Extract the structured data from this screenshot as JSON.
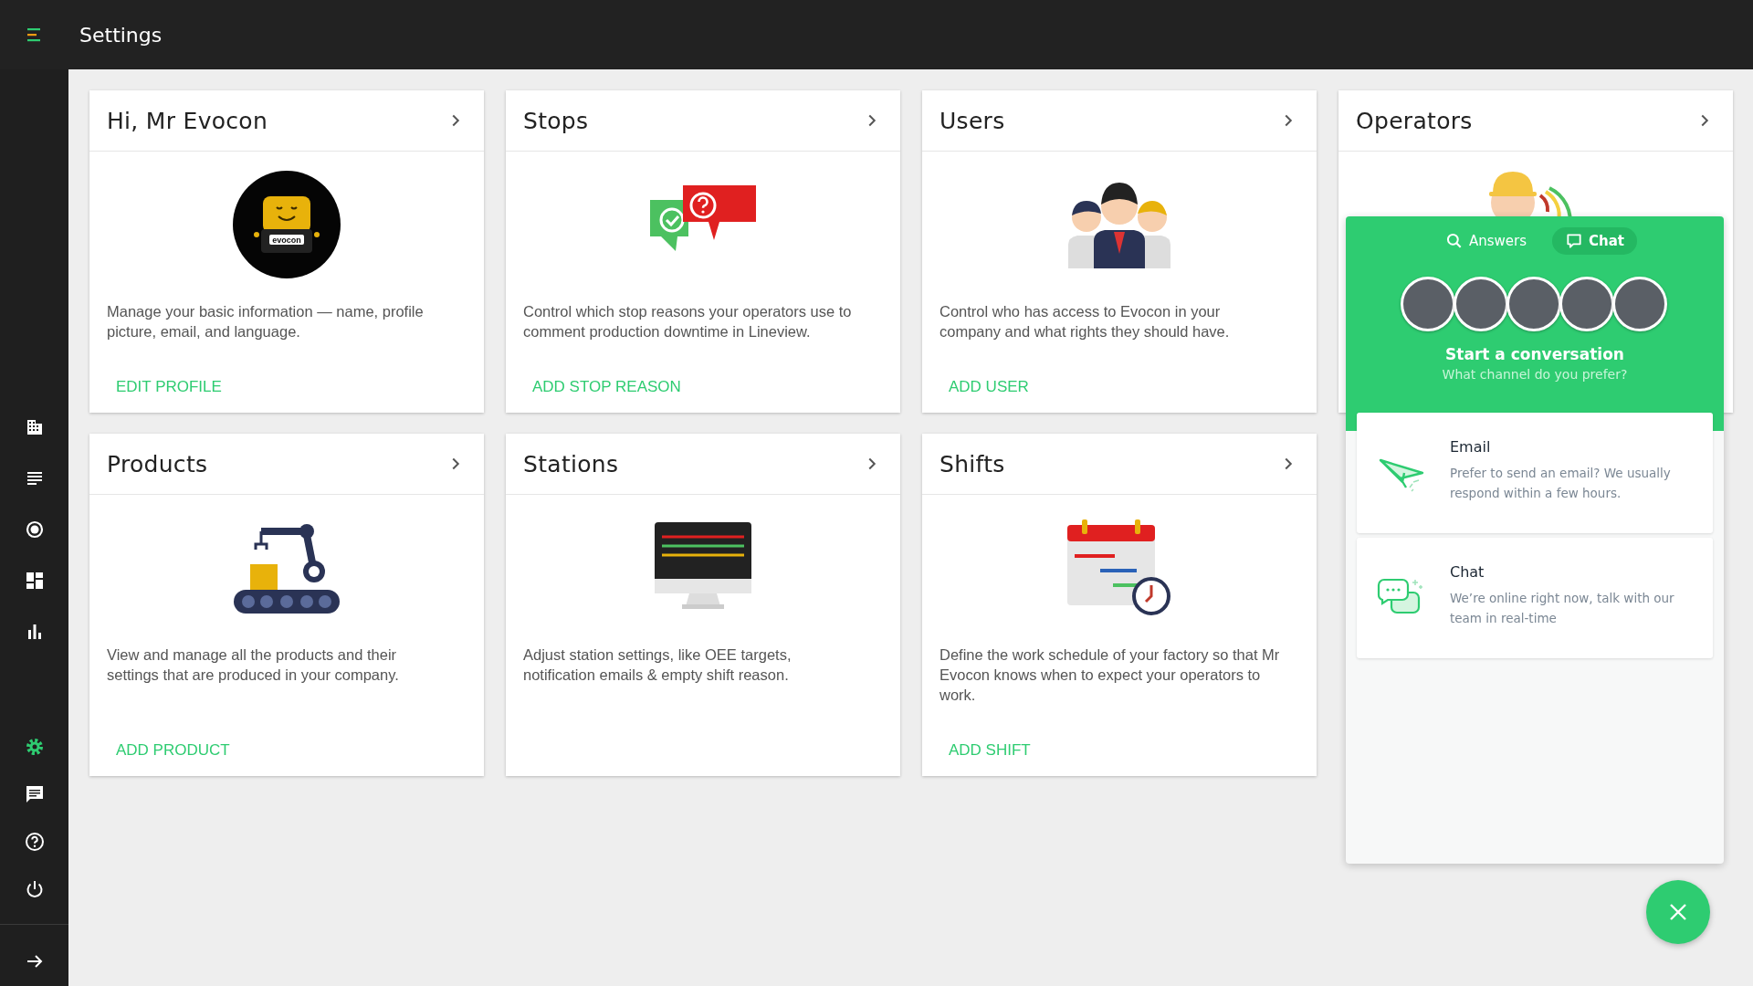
{
  "top_bar": {
    "title": "Settings"
  },
  "sidebar": {
    "items": [
      {
        "kind": "building",
        "selected": false
      },
      {
        "kind": "list",
        "selected": false
      },
      {
        "kind": "target",
        "selected": false
      },
      {
        "kind": "dashboard",
        "selected": false
      },
      {
        "kind": "chart",
        "selected": false
      },
      {
        "kind": "gear",
        "selected": true
      },
      {
        "kind": "chat",
        "selected": false
      },
      {
        "kind": "help",
        "selected": false
      },
      {
        "kind": "power",
        "selected": false
      },
      {
        "kind": "arrow",
        "selected": false
      }
    ]
  },
  "cards": [
    {
      "kind": "profile",
      "title": "Hi, Mr Evocon",
      "logo_text": "evocon",
      "description": "Manage your basic information — name, profile picture, email, and language.",
      "action": "EDIT PROFILE"
    },
    {
      "kind": "stops",
      "title": "Stops",
      "description": "Control which stop reasons your operators use to comment production downtime in Lineview.",
      "action": "ADD STOP REASON"
    },
    {
      "kind": "users",
      "title": "Users",
      "description": "Control who has access to Evocon in your company and what rights they should have.",
      "action": "ADD USER"
    },
    {
      "kind": "operators",
      "title": "Operators"
    },
    {
      "kind": "products",
      "title": "Products",
      "description": "View and manage all the products and their settings that are produced in your company.",
      "action": "ADD PRODUCT"
    },
    {
      "kind": "stations",
      "title": "Stations",
      "description": "Adjust station settings, like OEE targets, notification emails & empty shift reason."
    },
    {
      "kind": "shifts",
      "title": "Shifts",
      "description": "Define the work schedule of your factory so that Mr Evocon knows when to expect your operators to work.",
      "action": "ADD SHIFT"
    }
  ],
  "chat_widget": {
    "tabs": [
      {
        "kind": "search",
        "label": "Answers",
        "selected": false
      },
      {
        "kind": "chat",
        "label": "Chat",
        "selected": true
      }
    ],
    "title": "Start a conversation",
    "subtitle": "What channel do you prefer?",
    "options": [
      {
        "kind": "email",
        "title": "Email",
        "description": "Prefer to send an email? We usually respond within a few hours."
      },
      {
        "kind": "chat",
        "title": "Chat",
        "description": "We’re online right now, talk with our team in real-time"
      }
    ]
  }
}
